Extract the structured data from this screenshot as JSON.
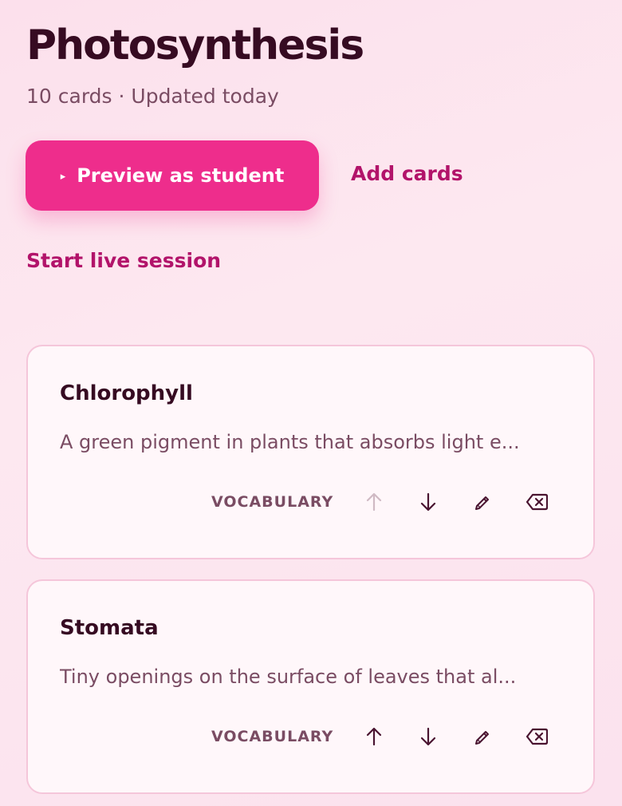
{
  "header": {
    "title": "Photosynthesis",
    "subtitle": "10 cards · Updated today"
  },
  "actions": {
    "preview_icon": "play-icon",
    "preview_symbol": "▸",
    "preview_label": "Preview as student",
    "add_cards_label": "Add cards",
    "live_session_label": "Start live session"
  },
  "colors": {
    "accent": "#ee2d8c",
    "link": "#b2136a",
    "title": "#360b22",
    "muted": "#7a4c63",
    "card_border": "#f5c6da"
  },
  "cards": [
    {
      "title": "Chlorophyll",
      "description": "A green pigment in plants that absorbs light e...",
      "tag": "VOCABULARY",
      "move_up_enabled": false,
      "move_down_enabled": true,
      "icons": [
        "arrow-up-icon",
        "arrow-down-icon",
        "pencil-icon",
        "backspace-delete-icon"
      ]
    },
    {
      "title": "Stomata",
      "description": "Tiny openings on the surface of leaves that al...",
      "tag": "VOCABULARY",
      "move_up_enabled": true,
      "move_down_enabled": true,
      "icons": [
        "arrow-up-icon",
        "arrow-down-icon",
        "pencil-icon",
        "backspace-delete-icon"
      ]
    }
  ]
}
